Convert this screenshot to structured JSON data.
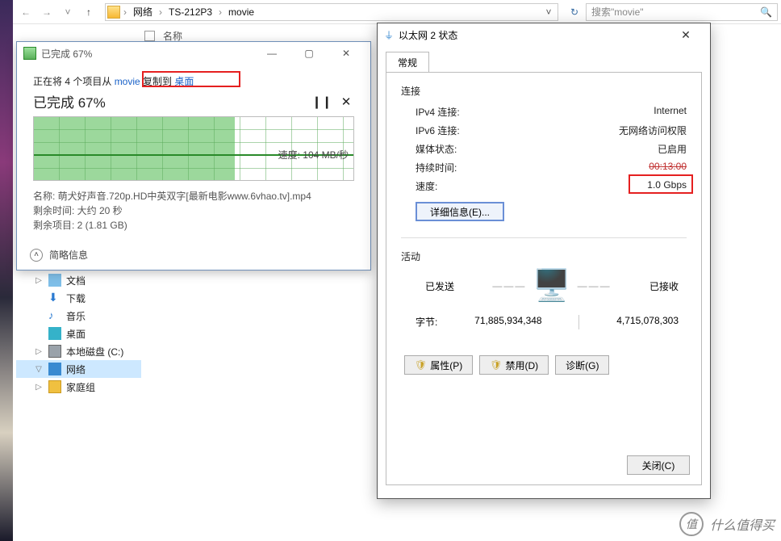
{
  "explorer": {
    "crumbs": [
      "网络",
      "TS-212P3",
      "movie"
    ],
    "search_placeholder": "搜索\"movie\"",
    "list_header_name": "名称"
  },
  "tree": {
    "items": [
      {
        "label": "文档",
        "icon": "doc"
      },
      {
        "label": "下载",
        "icon": "download"
      },
      {
        "label": "音乐",
        "icon": "music"
      },
      {
        "label": "桌面",
        "icon": "desktop"
      },
      {
        "label": "本地磁盘 (C:)",
        "icon": "disk"
      },
      {
        "label": "网络",
        "icon": "network",
        "selected": true,
        "chev": "▽"
      },
      {
        "label": "家庭组",
        "icon": "homegroup",
        "chev": "▷"
      }
    ]
  },
  "copy_dialog": {
    "title": "已完成 67%",
    "line_prefix": "正在将 4 个项目从 ",
    "src": "movie",
    "mid": " 复制到 ",
    "dest": "桌面",
    "heading": "已完成 67%",
    "speed_label": "速度: 104 MB/秒",
    "name_line": "名称: 萌犬好声音.720p.HD中英双字[最新电影www.6vhao.tv].mp4",
    "remain_time": "剩余时间: 大约 20 秒",
    "remain_items": "剩余项目: 2 (1.81 GB)",
    "footer": "简略信息",
    "pause_glyph": "❙❙",
    "close_glyph": "✕"
  },
  "net_dialog": {
    "title": "以太网 2 状态",
    "tab": "常规",
    "section_conn": "连接",
    "rows": [
      {
        "k": "IPv4 连接:",
        "v": "Internet"
      },
      {
        "k": "IPv6 连接:",
        "v": "无网络访问权限"
      },
      {
        "k": "媒体状态:",
        "v": "已启用"
      },
      {
        "k": "持续时间:",
        "v": "00:13:00",
        "strike": true
      },
      {
        "k": "速度:",
        "v": "1.0 Gbps"
      }
    ],
    "detail_btn": "详细信息(E)...",
    "section_act": "活动",
    "sent_label": "已发送",
    "recv_label": "已接收",
    "bytes_label": "字节:",
    "sent_bytes": "71,885,934,348",
    "recv_bytes": "4,715,078,303",
    "btn_props": "属性(P)",
    "btn_disable": "禁用(D)",
    "btn_diag": "诊断(G)",
    "btn_close": "关闭(C)"
  },
  "watermark": {
    "brand": "值",
    "text": "什么值得买"
  }
}
